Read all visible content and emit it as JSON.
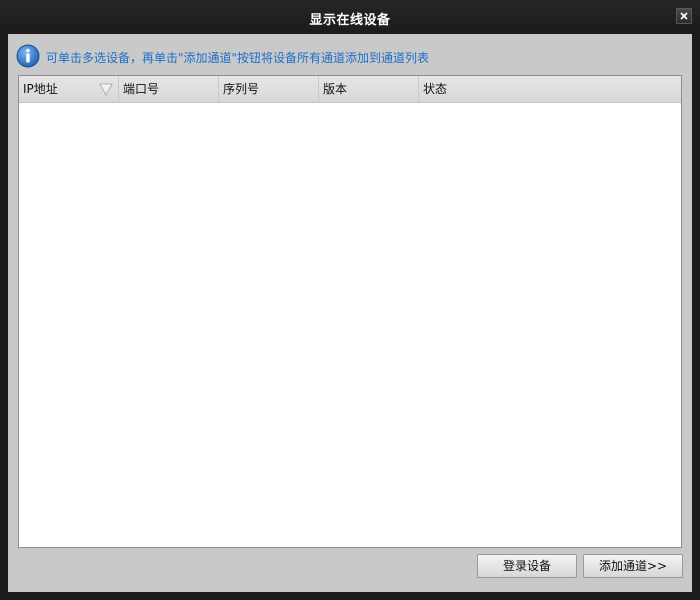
{
  "window": {
    "title": "显示在线设备"
  },
  "hint": {
    "text": "可单击多选设备，再单击\"添加通道\"按钮将设备所有通道添加到通道列表",
    "color": "#1f6fc8"
  },
  "table": {
    "columns": [
      "IP地址",
      "端口号",
      "序列号",
      "版本",
      "状态"
    ],
    "rows": []
  },
  "buttons": {
    "login_label": "登录设备",
    "add_channel_label": "添加通道>>"
  },
  "icons": {
    "info": "info-icon",
    "close": "close-icon",
    "sort": "sort-indicator-icon"
  }
}
